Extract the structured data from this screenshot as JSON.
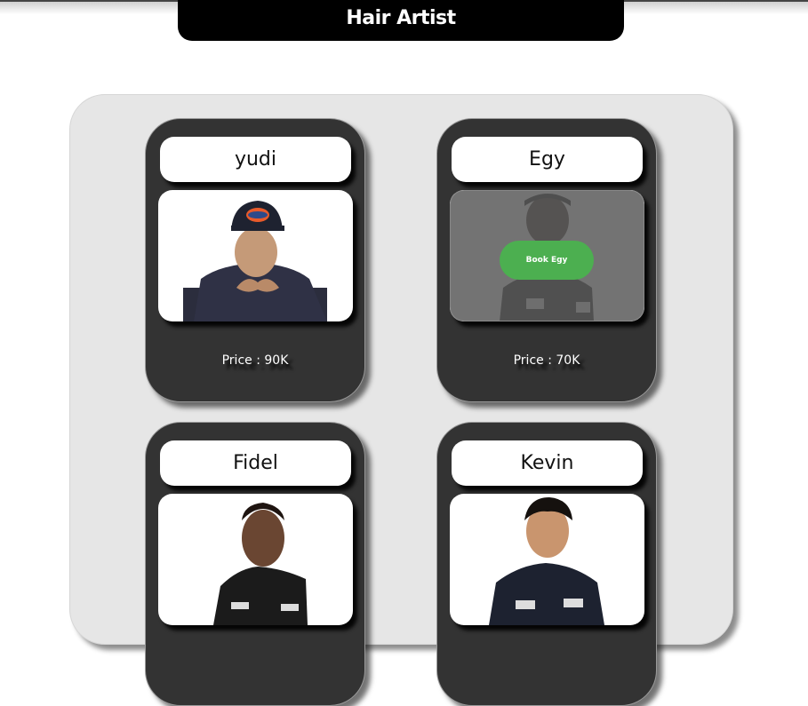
{
  "header": {
    "title": "Hair Artist"
  },
  "artists": [
    {
      "name": "yudi",
      "price": "Price : 90K",
      "icon": "barber-photo"
    },
    {
      "name": "Egy",
      "price": "Price : 70K",
      "icon": "barber-photo",
      "book_label": "Book Egy"
    },
    {
      "name": "Fidel",
      "icon": "barber-photo"
    },
    {
      "name": "Kevin",
      "icon": "barber-photo"
    }
  ],
  "colors": {
    "card": "#333333",
    "panel": "#e6e6e6",
    "book_button": "#4caf50"
  }
}
